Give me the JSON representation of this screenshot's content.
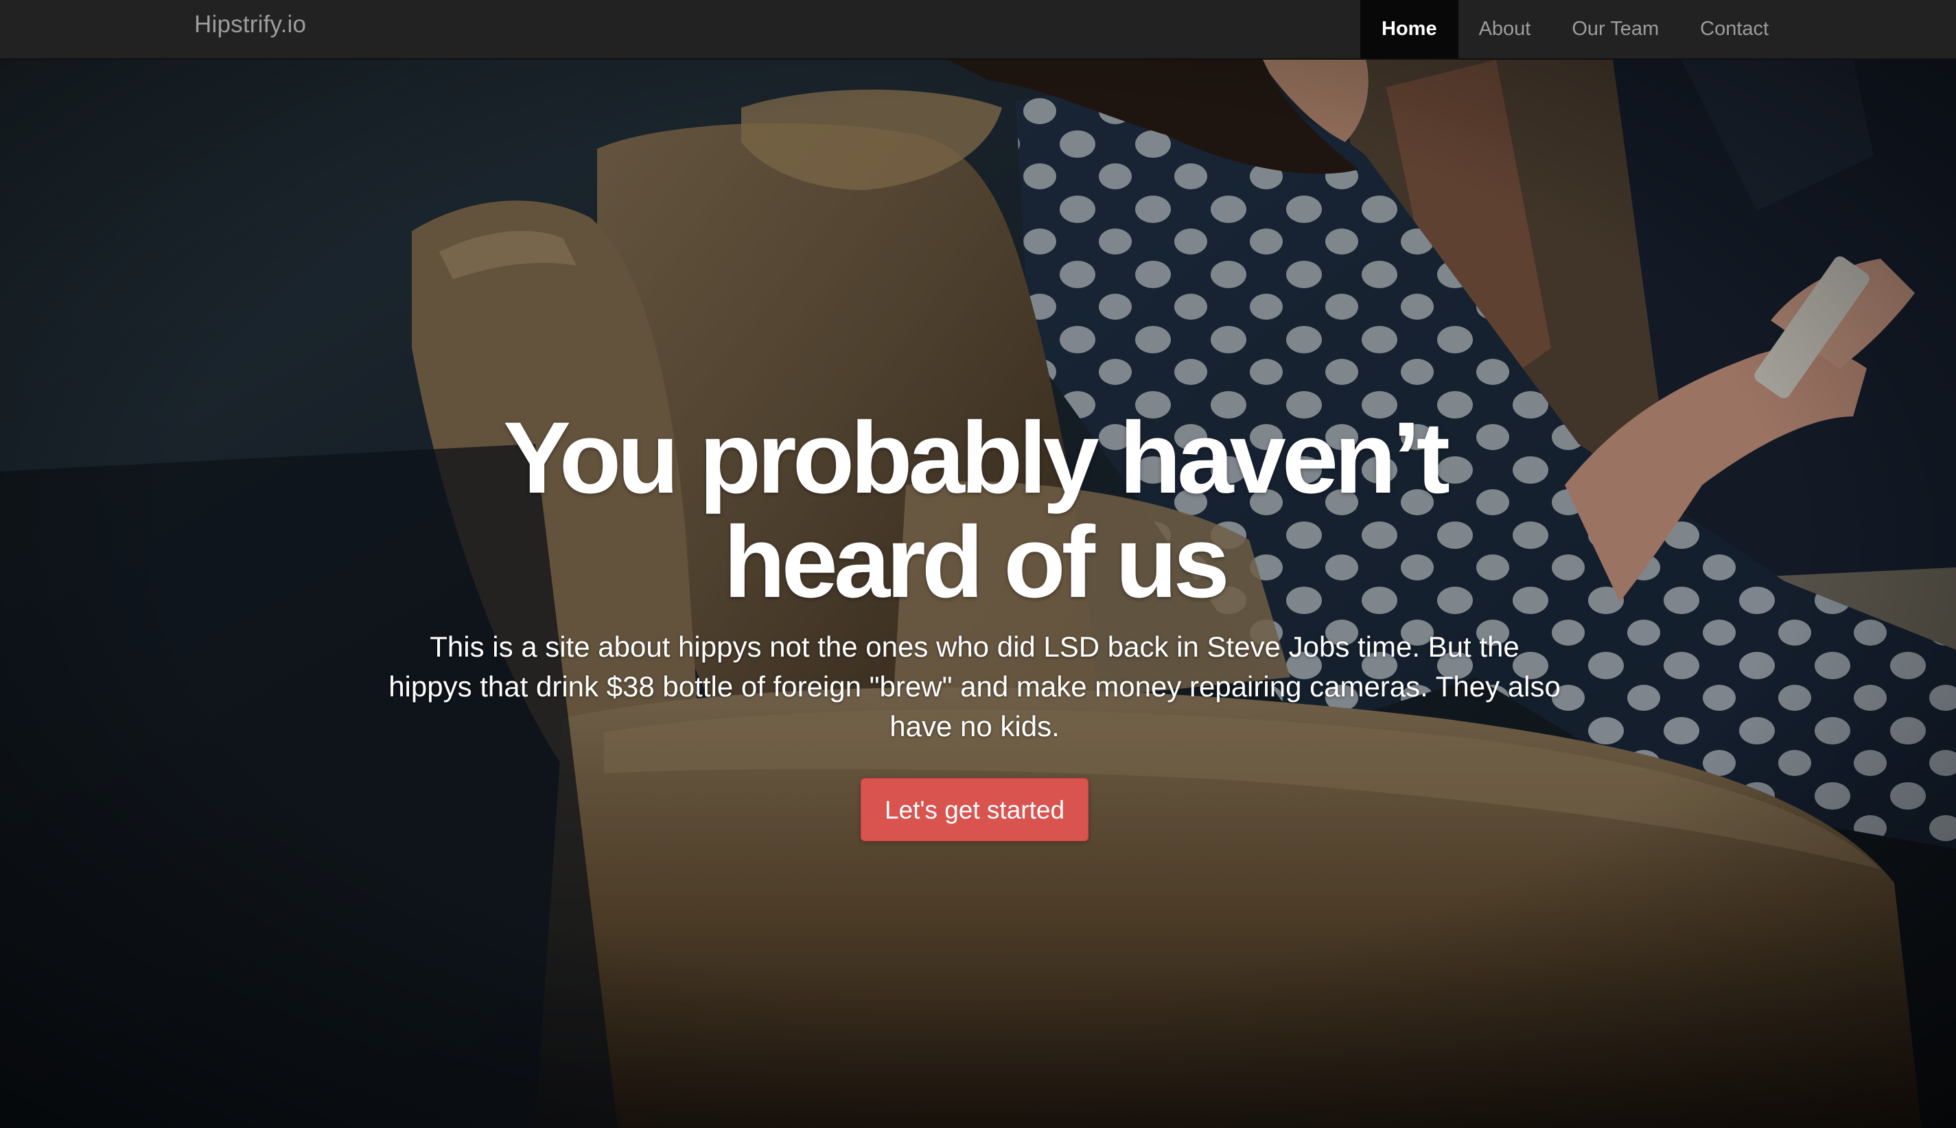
{
  "navbar": {
    "brand": "Hipstrify.io",
    "items": [
      {
        "label": "Home",
        "active": true
      },
      {
        "label": "About",
        "active": false
      },
      {
        "label": "Our Team",
        "active": false
      },
      {
        "label": "Contact",
        "active": false
      }
    ]
  },
  "hero": {
    "title": "You probably haven’t heard of us",
    "text": "This is a site about hippys not the ones who did LSD back in Steve Jobs time. But the hippys that drink $38 bottle of foreign \"brew\" and make money repairing cameras. They also have no kids.",
    "button_label": "Let's get started",
    "button_color": "#d9534f",
    "background_image": "woman-in-polka-dot-shirt-on-armchair-with-phone"
  },
  "colors": {
    "navbar_bg": "#222222",
    "nav_active_bg": "#080808",
    "nav_text": "#9d9d9d",
    "nav_active_text": "#ffffff"
  }
}
